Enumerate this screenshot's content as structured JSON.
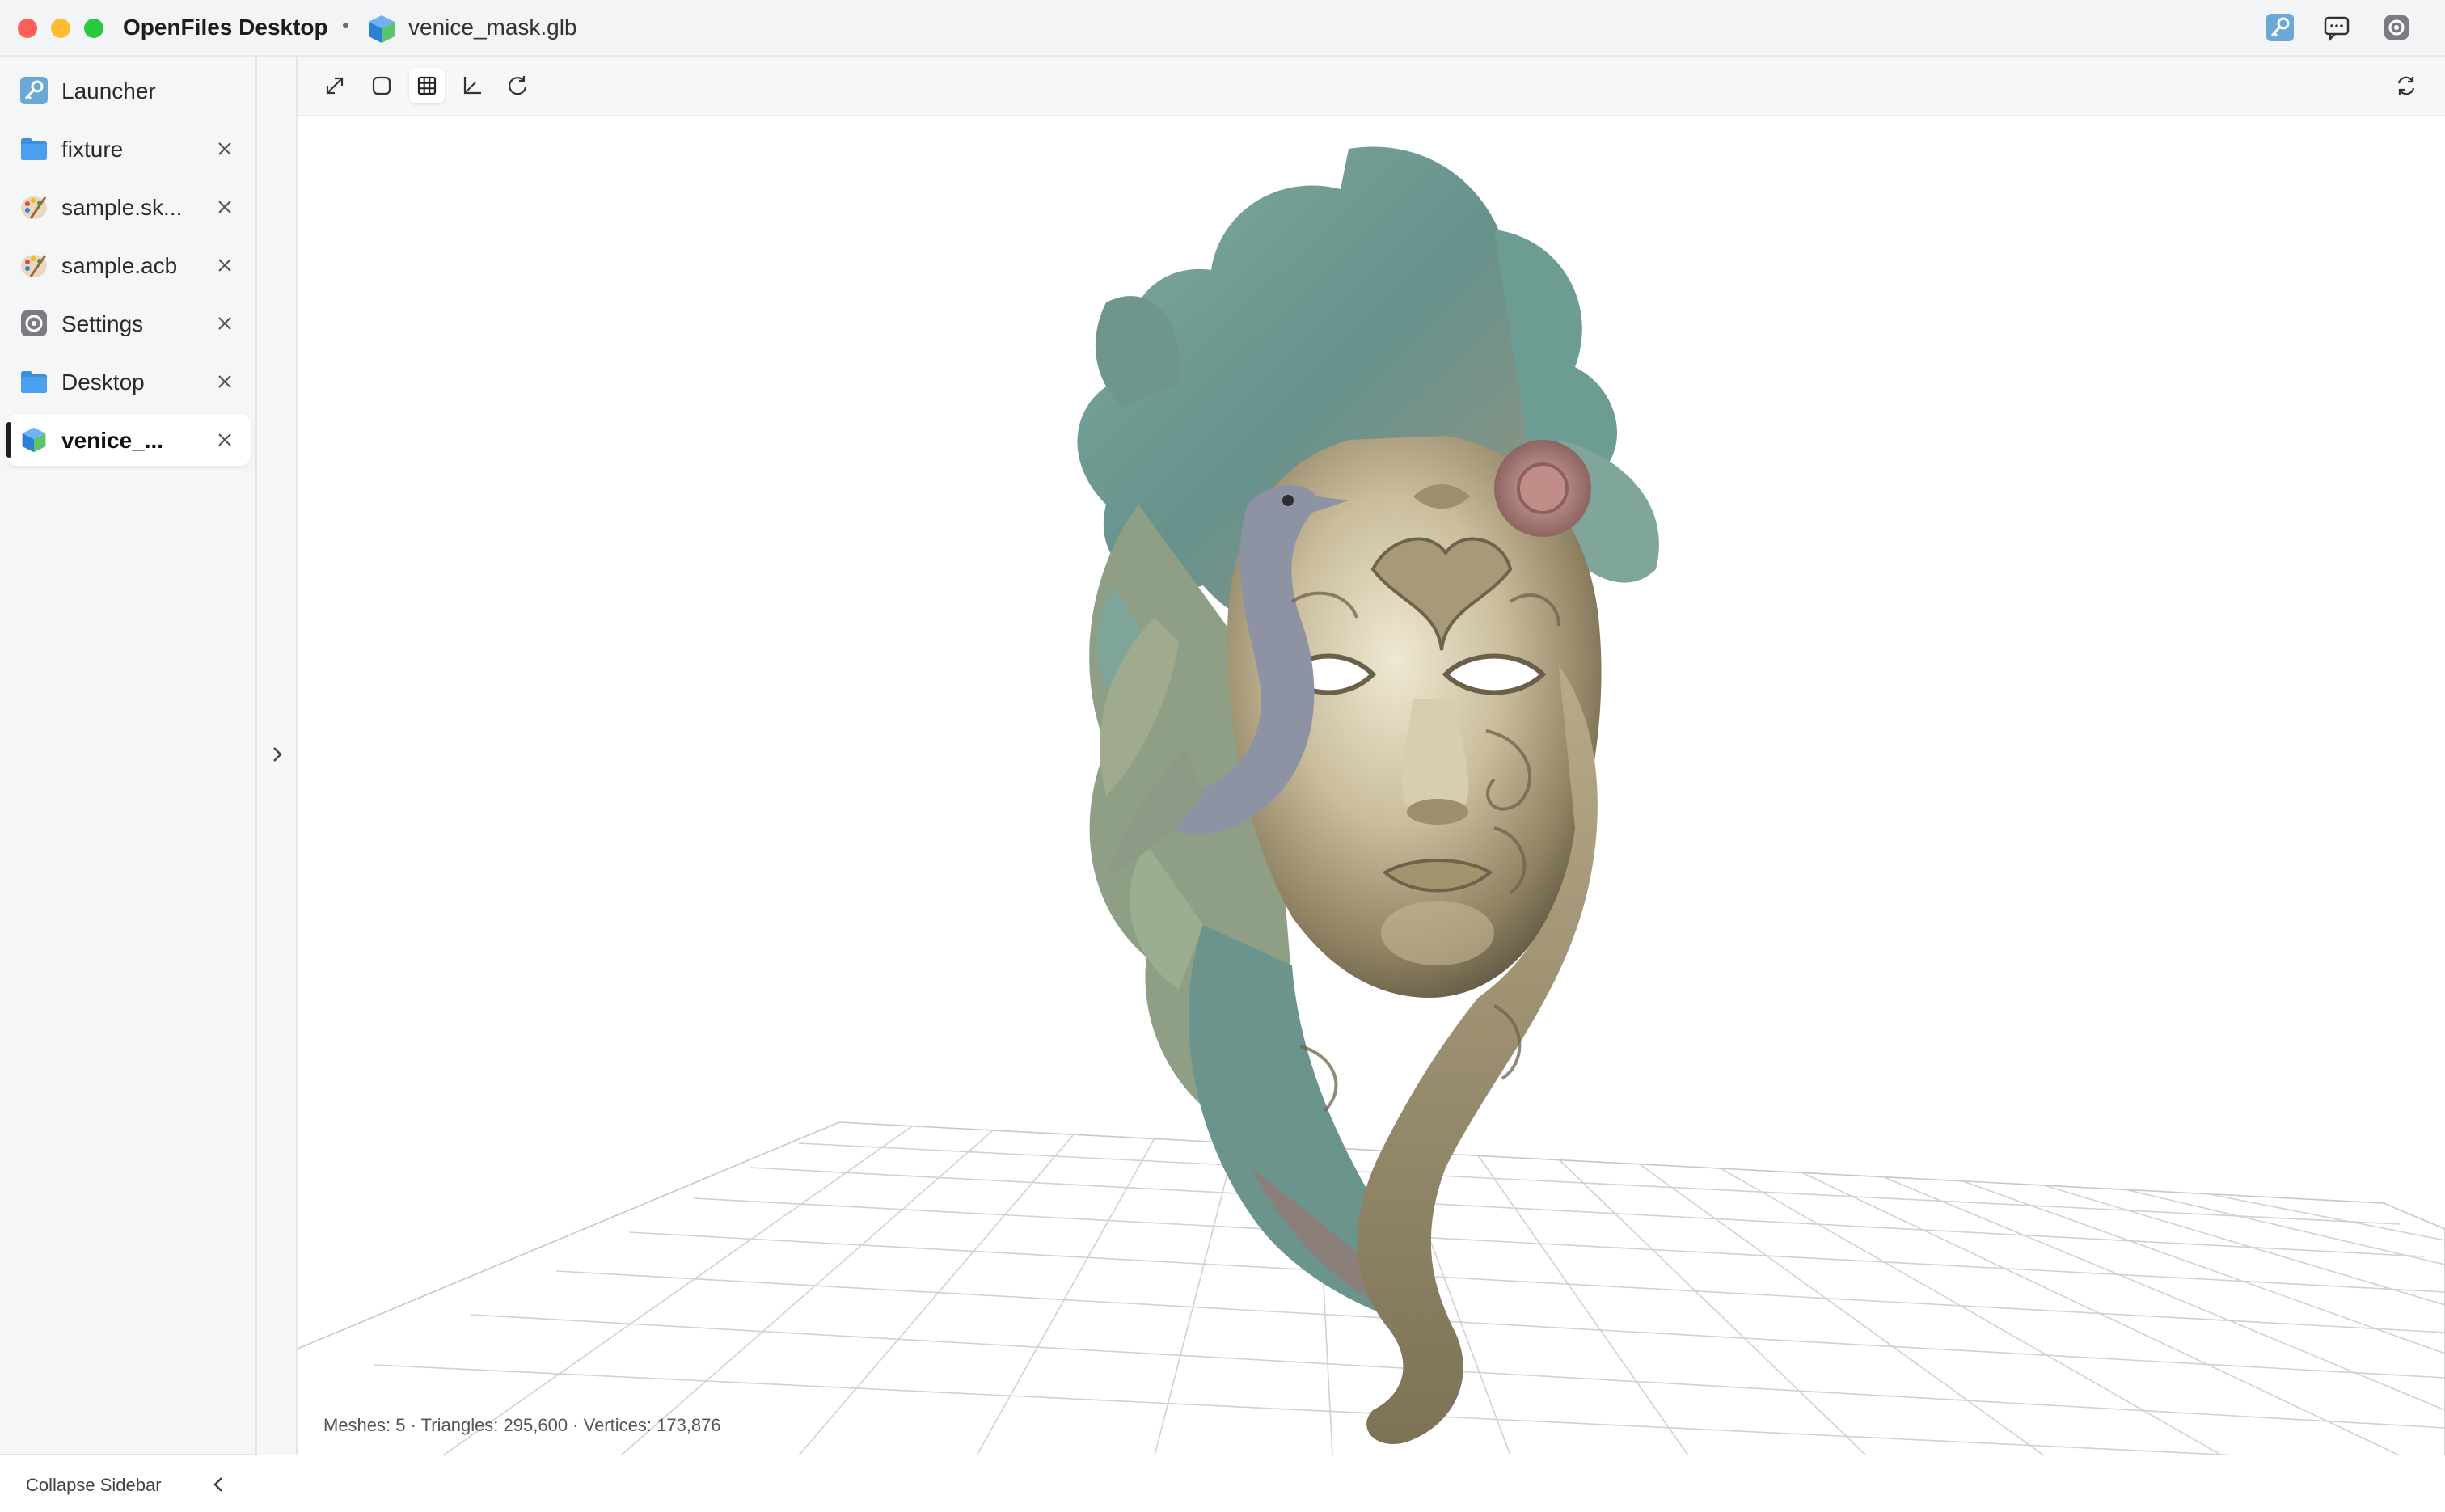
{
  "titlebar": {
    "app_name": "OpenFiles Desktop",
    "separator": "•",
    "file_name": "venice_mask.glb",
    "right_icons": [
      "launcher-key-icon",
      "chat-icon",
      "settings-gear-icon"
    ]
  },
  "sidebar": {
    "tabs": [
      {
        "label": "Launcher",
        "icon": "key-icon",
        "closable": false
      },
      {
        "label": "fixture",
        "icon": "folder-icon",
        "closable": true
      },
      {
        "label": "sample.sk...",
        "icon": "palette-icon",
        "closable": true
      },
      {
        "label": "sample.acb",
        "icon": "palette-icon",
        "closable": true
      },
      {
        "label": "Settings",
        "icon": "gear-icon",
        "closable": true
      },
      {
        "label": "Desktop",
        "icon": "folder-icon",
        "closable": true
      },
      {
        "label": "venice_...",
        "icon": "cube-icon",
        "closable": true,
        "active": true
      }
    ],
    "collapse_label": "Collapse Sidebar"
  },
  "viewer": {
    "tools": [
      "fullscreen-icon",
      "bounding-box-icon",
      "grid-icon",
      "axes-icon",
      "rotate-icon"
    ],
    "active_tool": "grid-icon",
    "refresh_icon": "refresh-icon",
    "stats": "Meshes: 5 · Triangles: 295,600 · Vertices: 173,876"
  },
  "colors": {
    "accent": "#1d1d1f",
    "folder": "#3b8fe0",
    "sidebar_bg": "#f5f6f7"
  }
}
